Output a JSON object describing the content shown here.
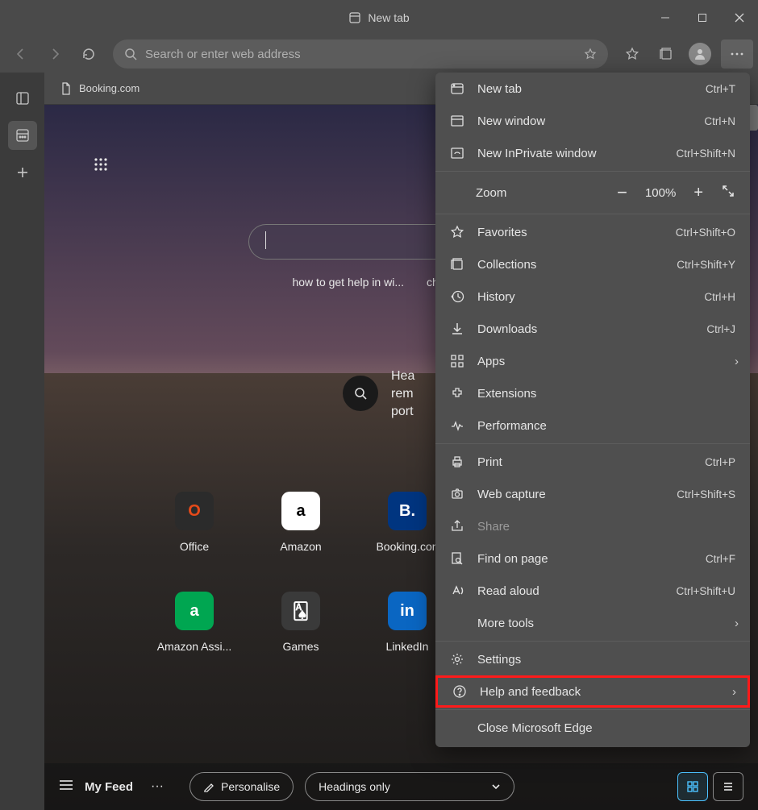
{
  "titlebar": {
    "title": "New tab"
  },
  "address": {
    "placeholder": "Search or enter web address"
  },
  "tab": {
    "label": "Booking.com"
  },
  "trending": [
    "how to get help in wi...",
    "change windows"
  ],
  "news": {
    "line1": "Hea",
    "line2": "rem",
    "line3": "port"
  },
  "tiles": [
    {
      "label": "Office",
      "glyph": "O"
    },
    {
      "label": "Amazon",
      "glyph": "a"
    },
    {
      "label": "Booking.con",
      "glyph": "B."
    },
    {
      "label": "Amazon Assi...",
      "glyph": "a"
    },
    {
      "label": "Games",
      "glyph": "🂡"
    },
    {
      "label": "LinkedIn",
      "glyph": "in"
    }
  ],
  "feed": {
    "title": "My Feed",
    "personalise": "Personalise",
    "headings": "Headings only"
  },
  "menu": {
    "newtab": {
      "label": "New tab",
      "sc": "Ctrl+T"
    },
    "newwin": {
      "label": "New window",
      "sc": "Ctrl+N"
    },
    "inprivate": {
      "label": "New InPrivate window",
      "sc": "Ctrl+Shift+N"
    },
    "zoom": {
      "label": "Zoom",
      "value": "100%"
    },
    "favorites": {
      "label": "Favorites",
      "sc": "Ctrl+Shift+O"
    },
    "collections": {
      "label": "Collections",
      "sc": "Ctrl+Shift+Y"
    },
    "history": {
      "label": "History",
      "sc": "Ctrl+H"
    },
    "downloads": {
      "label": "Downloads",
      "sc": "Ctrl+J"
    },
    "apps": {
      "label": "Apps"
    },
    "extensions": {
      "label": "Extensions"
    },
    "performance": {
      "label": "Performance"
    },
    "print": {
      "label": "Print",
      "sc": "Ctrl+P"
    },
    "capture": {
      "label": "Web capture",
      "sc": "Ctrl+Shift+S"
    },
    "share": {
      "label": "Share"
    },
    "find": {
      "label": "Find on page",
      "sc": "Ctrl+F"
    },
    "readaloud": {
      "label": "Read aloud",
      "sc": "Ctrl+Shift+U"
    },
    "moretools": {
      "label": "More tools"
    },
    "settings": {
      "label": "Settings"
    },
    "help": {
      "label": "Help and feedback"
    },
    "close": {
      "label": "Close Microsoft Edge"
    }
  }
}
